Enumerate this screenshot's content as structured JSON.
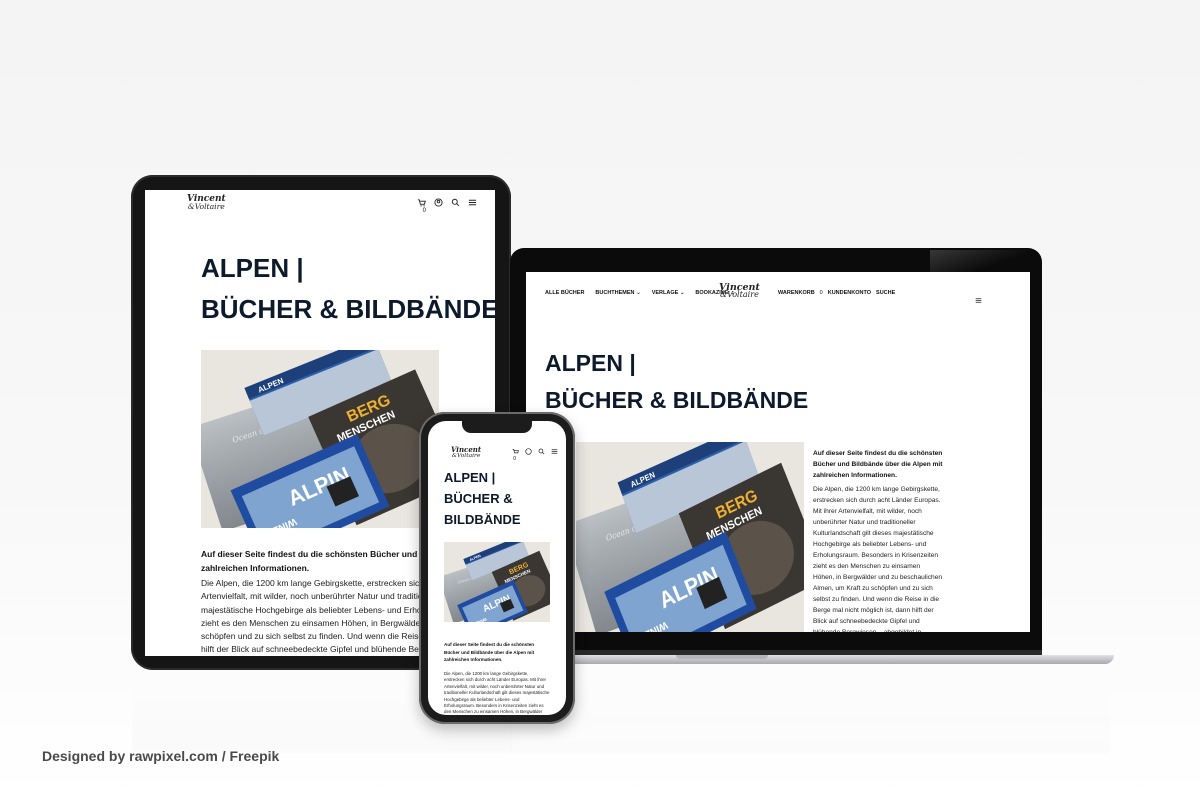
{
  "site": {
    "logo_line1": "Vincent",
    "logo_line2": "&Voltaire",
    "cart_count": "0"
  },
  "nav": {
    "all_books": "ALLE BÜCHER",
    "topics": "BUCHTHEMEN",
    "publishers": "VERLAGE",
    "bookazines": "BOOKAZINE",
    "cart": "WARENKORB",
    "cart_count": "0",
    "account": "KUNDENKONTO",
    "search": "SUCHE"
  },
  "page": {
    "title_line1": "ALPEN |",
    "title_line2": "BÜCHER & BILDBÄNDE",
    "phone_title_line1": "ALPEN |",
    "phone_title_line2": "BÜCHER &",
    "phone_title_line3": "BILDBÄNDE",
    "intro": "Auf dieser Seite findest du die schönsten Bücher und Bildbände über die Alpen mit zahlreichen Informationen.",
    "body": "Die Alpen, die 1200 km lange Gebirgskette, erstrecken sich durch acht Länder Europas. Mit ihrer Artenvielfalt, mit wilder, noch unberührter Natur und traditioneller Kulturlandschaft gilt dieses majestätische Hochgebirge als beliebter Lebens- und Erholungsraum. Besonders in Krisenzeiten zieht es den Menschen zu einsamen Höhen, in Bergwälder und zu beschaulichen Almen, um Kraft zu schöpfen und zu sich selbst zu finden. Und wenn die Reise in die Berge mal nicht möglich ist, dann hilft der Blick auf schneebedeckte Gipfel und blühende Bergwiesen – abgebildet in",
    "tablet_body_tail": "Und wenn die Reise in die Berge mal nicht möglich ist, dann hilft der"
  },
  "books": {
    "alpen": "ALPEN",
    "berg": "BERG",
    "menschen": "MENSCHEN",
    "alpin": "ALPIN",
    "winzig": "WINZIG",
    "ocean": "Ocean of Clouds"
  },
  "credit": "Designed by rawpixel.com / Freepik",
  "colors": {
    "title": "#0d1a2c",
    "device_frame": "#1a1a1a",
    "laptop_base": "#c8c8ca"
  }
}
